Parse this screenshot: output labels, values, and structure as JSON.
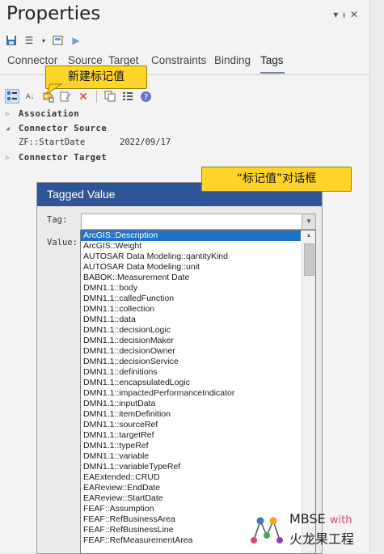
{
  "window": {
    "title": "Properties"
  },
  "tabs": [
    "Connector",
    "Source",
    "Target",
    "Constraints",
    "Binding",
    "Tags"
  ],
  "tree": {
    "association": "Association",
    "connector_source": "Connector Source",
    "tag_row": {
      "name": "ZF::StartDate",
      "value": "2022/09/17"
    },
    "connector_target": "Connector Target"
  },
  "callouts": {
    "new_tag": "新建标记值",
    "dialog": "“标记值”对话框"
  },
  "dialog": {
    "title": "Tagged Value",
    "tag_label": "Tag:",
    "value_label": "Value:",
    "tag_value": ""
  },
  "dropdown_items": [
    "ArcGIS::Description",
    "ArcGIS::Weight",
    "AUTOSAR Data Modeling::qantityKind",
    "AUTOSAR Data Modeling::unit",
    "BABOK::Measurement Date",
    "DMN1.1::body",
    "DMN1.1::calledFunction",
    "DMN1.1::collection",
    "DMN1.1::data",
    "DMN1.1::decisionLogic",
    "DMN1.1::decisionMaker",
    "DMN1.1::decisionOwner",
    "DMN1.1::decisionService",
    "DMN1.1::definitions",
    "DMN1.1::encapsulatedLogic",
    "DMN1.1::impactedPerformanceIndicator",
    "DMN1.1::inputData",
    "DMN1.1::itemDefinition",
    "DMN1.1::sourceRef",
    "DMN1.1::targetRef",
    "DMN1.1::typeRef",
    "DMN1.1::variable",
    "DMN1.1::variableTypeRef",
    "EAExtended::CRUD",
    "EAReview::EndDate",
    "EAReview::StartDate",
    "FEAF::Assumption",
    "FEAF::RefBusinessArea",
    "FEAF::RefBusinessLine",
    "FEAF::RefMeasurementArea"
  ],
  "selected_index": 0,
  "logo": {
    "line1": "MBSE",
    "with": "with",
    "line2": "火龙果工程"
  },
  "colors": {
    "dialog_title": "#2f5597",
    "selection": "#1e73c8",
    "callout": "#ffd42a",
    "logo_pink": "#e0447a"
  }
}
